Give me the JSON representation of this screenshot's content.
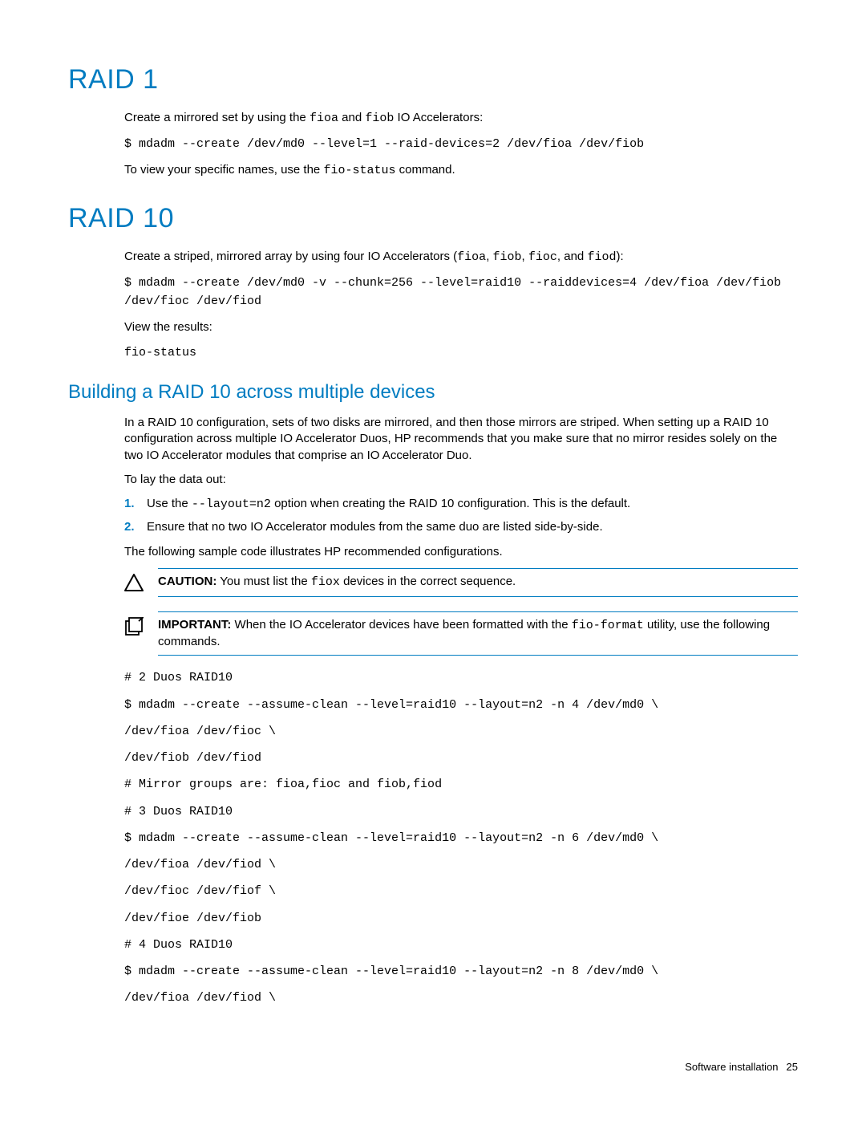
{
  "raid1": {
    "heading": "RAID 1",
    "intro_before": "Create a mirrored set by using the ",
    "intro_code1": "fioa",
    "intro_mid": " and ",
    "intro_code2": "fiob",
    "intro_after": " IO Accelerators:",
    "command": "$ mdadm --create /dev/md0 --level=1 --raid-devices=2 /dev/fioa /dev/fiob",
    "view_before": "To view your specific names, use the ",
    "view_code": "fio-status",
    "view_after": " command."
  },
  "raid10": {
    "heading": "RAID 10",
    "intro_before": "Create a striped, mirrored array by using four IO Accelerators (",
    "c1": "fioa",
    "s1": ", ",
    "c2": "fiob",
    "s2": ", ",
    "c3": "fioc",
    "s3": ", and ",
    "c4": "fiod",
    "s4": "):",
    "command": "$ mdadm --create /dev/md0 -v --chunk=256 --level=raid10 --raiddevices=4 /dev/fioa /dev/fiob /dev/fioc /dev/fiod",
    "view_label": "View the results:",
    "view_cmd": "fio-status"
  },
  "building": {
    "heading": "Building a RAID 10 across multiple devices",
    "para": "In a RAID 10 configuration, sets of two disks are mirrored, and then those mirrors are striped. When setting up a RAID 10 configuration across multiple IO Accelerator Duos, HP recommends that you make sure that no mirror resides solely on the two IO Accelerator modules that comprise an IO Accelerator Duo.",
    "lay_label": "To lay the data out:",
    "step1_num": "1.",
    "step1_before": "Use the ",
    "step1_code": "--layout=n2",
    "step1_after": " option when creating the RAID 10 configuration. This is the default.",
    "step2_num": "2.",
    "step2_text": "Ensure that no two IO Accelerator modules from the same duo are listed side-by-side.",
    "following": "The following sample code illustrates HP recommended configurations."
  },
  "caution": {
    "label": "CAUTION:",
    "before": "   You must list the ",
    "code": "fiox",
    "after": " devices in the correct sequence."
  },
  "important": {
    "label": "IMPORTANT:",
    "before": "   When the IO Accelerator devices have been formatted with the ",
    "code": "fio-format",
    "after": " utility, use the following commands."
  },
  "sample": {
    "l1": "# 2 Duos RAID10",
    "l2": "$ mdadm --create --assume-clean --level=raid10 --layout=n2 -n 4 /dev/md0 \\",
    "l3": "/dev/fioa /dev/fioc \\",
    "l4": "/dev/fiob /dev/fiod",
    "l5": "# Mirror groups are: fioa,fioc and fiob,fiod",
    "l6": "# 3 Duos RAID10",
    "l7": "$ mdadm --create --assume-clean --level=raid10 --layout=n2 -n 6 /dev/md0 \\",
    "l8": "/dev/fioa /dev/fiod \\",
    "l9": "/dev/fioc /dev/fiof \\",
    "l10": "/dev/fioe /dev/fiob",
    "l11": "# 4 Duos RAID10",
    "l12": "$ mdadm --create --assume-clean --level=raid10 --layout=n2 -n 8 /dev/md0 \\",
    "l13": "/dev/fioa /dev/fiod \\"
  },
  "footer": {
    "section": "Software installation",
    "page": "25"
  }
}
